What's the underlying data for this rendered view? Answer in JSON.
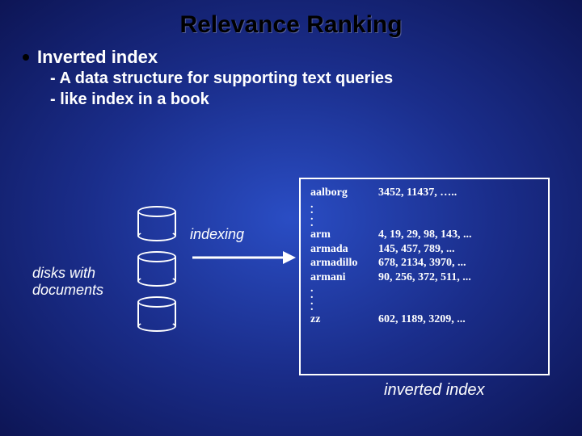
{
  "title": "Relevance Ranking",
  "heading": "Inverted index",
  "sub1": "- A data structure for supporting text queries",
  "sub2": "- like index in a book",
  "disks_label_l1": "disks with",
  "disks_label_l2": "documents",
  "indexing_label": "indexing",
  "inverted_label": "inverted index",
  "chart_data": {
    "type": "table",
    "title": "inverted index",
    "entries": [
      {
        "term": "aalborg",
        "postings": "3452, 11437, ….."
      },
      {
        "term": "arm",
        "postings": "4, 19, 29, 98, 143, ..."
      },
      {
        "term": "armada",
        "postings": "145, 457, 789, ..."
      },
      {
        "term": "armadillo",
        "postings": "678, 2134, 3970, ..."
      },
      {
        "term": "armani",
        "postings": "90, 256, 372, 511, ..."
      },
      {
        "term": "zz",
        "postings": "602, 1189, 3209, ..."
      }
    ]
  }
}
